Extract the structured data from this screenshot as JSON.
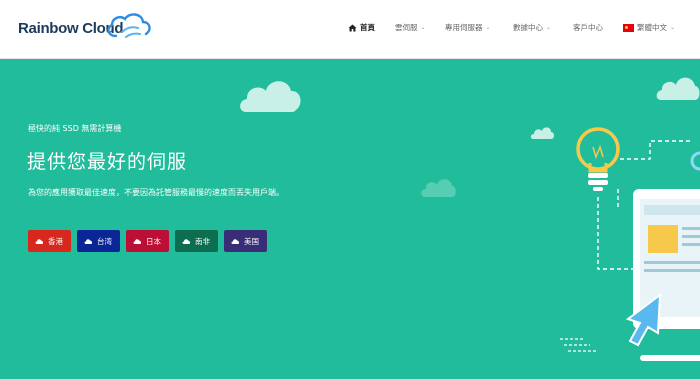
{
  "brand": {
    "name": "Rainbow Cloud"
  },
  "nav": {
    "items": [
      {
        "label": "首頁",
        "icon": "home-icon",
        "active": true,
        "dropdown": false
      },
      {
        "label": "雲伺服",
        "dropdown": true
      },
      {
        "label": "專用伺服器",
        "dropdown": true
      },
      {
        "label": "數據中心",
        "dropdown": true
      },
      {
        "label": "客戶中心",
        "dropdown": false
      },
      {
        "label": "繁體中文",
        "icon": "flag-icon",
        "dropdown": true
      }
    ]
  },
  "hero": {
    "tagline": "極快的純 SSD 無需計算機",
    "headline": "提供您最好的伺服",
    "subline": "為您的應用獲取最佳速度，不要因為託管服務最慢的速度而丟失用戶端。",
    "buttons": [
      {
        "label": "香港",
        "color": "#d6281c"
      },
      {
        "label": "台湾",
        "color": "#0a2596"
      },
      {
        "label": "日本",
        "color": "#bc0f35"
      },
      {
        "label": "南非",
        "color": "#0d6e4f"
      },
      {
        "label": "美国",
        "color": "#3a2d78"
      }
    ]
  },
  "colors": {
    "hero_bg": "#20bc9b",
    "header_bg": "#ffffff",
    "text_dark": "#1e3a5a"
  }
}
